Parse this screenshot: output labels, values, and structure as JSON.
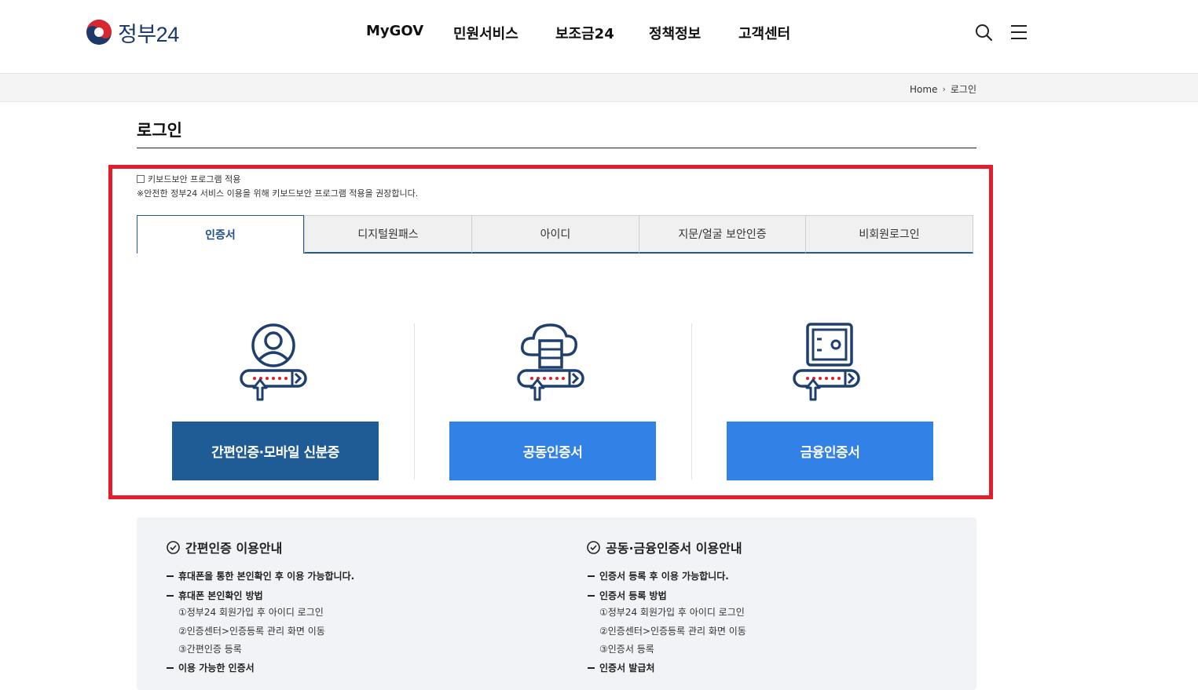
{
  "header": {
    "logo_text": "정부24",
    "nav": [
      "MyGOV",
      "민원서비스",
      "보조금24",
      "정책정보",
      "고객센터"
    ],
    "icons": [
      "search-icon",
      "menu-icon"
    ]
  },
  "breadcrumb": {
    "home": "Home",
    "current": "로그인"
  },
  "page_title": "로그인",
  "keyboard_security": {
    "label": "키보드보안 프로그램 적용",
    "checked": false,
    "note": "※안전한 정부24 서비스 이용을 위해 키보드보안 프로그램 적용을 권장합니다."
  },
  "tabs": [
    {
      "label": "인증서",
      "active": true
    },
    {
      "label": "디지털원패스",
      "active": false
    },
    {
      "label": "아이디",
      "active": false
    },
    {
      "label": "지문/얼굴 보안인증",
      "active": false
    },
    {
      "label": "비회원로그인",
      "active": false
    }
  ],
  "login_options": [
    {
      "label": "간편인증·모바일 신분증",
      "icon": "person-login-icon",
      "color": "#1f5b94"
    },
    {
      "label": "공동인증서",
      "icon": "cloud-login-icon",
      "color": "#3181e6"
    },
    {
      "label": "금융인증서",
      "icon": "safe-login-icon",
      "color": "#3181e6"
    }
  ],
  "info": {
    "simple": {
      "title": "간편인증 이용안내",
      "lines": [
        {
          "text": "휴대폰을 통한 본인확인 후 이용 가능합니다.",
          "bullet": true
        },
        {
          "text": "휴대폰 본인확인 방법",
          "bullet": true
        },
        {
          "text": "①정부24 회원가입 후 아이디 로그인",
          "bullet": false
        },
        {
          "text": "②인증센터>인증등록 관리 화면 이동",
          "bullet": false
        },
        {
          "text": "③간편인증 등록",
          "bullet": false
        },
        {
          "text": "이용 가능한 인증서",
          "bullet": true
        }
      ]
    },
    "cert": {
      "title": "공동·금융인증서 이용안내",
      "lines": [
        {
          "text": "인증서 등록 후 이용 가능합니다.",
          "bullet": true
        },
        {
          "text": "인증서 등록 방법",
          "bullet": true
        },
        {
          "text": "①정부24 회원가입 후 아이디 로그인",
          "bullet": false
        },
        {
          "text": "②인증센터>인증등록 관리 화면 이동",
          "bullet": false
        },
        {
          "text": "③인증서 등록",
          "bullet": false
        },
        {
          "text": "인증서 발급처",
          "bullet": true
        }
      ]
    }
  },
  "colors": {
    "highlight": "#e31d2b",
    "primary_dark": "#1f5b94",
    "primary": "#3181e6"
  }
}
